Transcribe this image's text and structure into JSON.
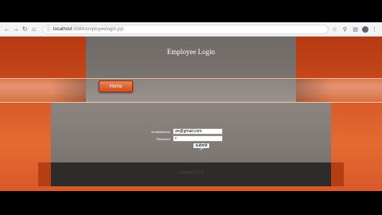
{
  "browser": {
    "url_host": "localhost",
    "url_path": ":8084/employeelogin.jsp",
    "icons": [
      "back-arrow-icon",
      "forward-arrow-icon",
      "reload-icon",
      "home-icon",
      "lock-icon",
      "bookmark-star-icon",
      "zoom-icon",
      "extension-icon",
      "profile-avatar",
      "menu-icon"
    ]
  },
  "page": {
    "title": "Employee Login",
    "home_label": "Home",
    "footer_text": "copyright 2018",
    "colors": {
      "primary_orange": "#d85a26",
      "panel_gray": "#7c7571",
      "footer_dark": "#2f2b2a"
    }
  },
  "login": {
    "username_label": "emailaddress",
    "username_value": "an@gmail.com",
    "password_label": "Password",
    "password_value": "•",
    "submit_label": "submit"
  }
}
